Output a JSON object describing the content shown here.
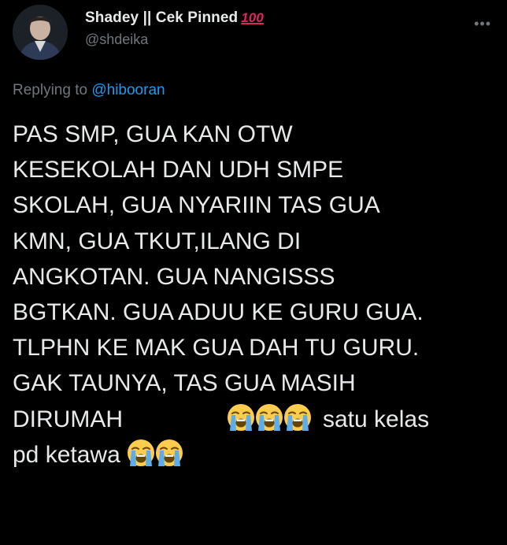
{
  "author": {
    "display_name": "Shadey || Cek Pinned",
    "name_emoji": "100",
    "handle": "@shdeika",
    "more_icon": "more-icon"
  },
  "reply": {
    "prefix": "Replying to",
    "handle": "@hibooran"
  },
  "tweet": {
    "lines": [
      "PAS SMP, GUA KAN OTW",
      "KESEKOLAH DAN UDH SMPE",
      "SKOLAH, GUA NYARIIN TAS GUA",
      "KMN, GUA TKUT,ILANG DI",
      "ANGKOTAN. GUA NANGISSS",
      "BGTKAN. GUA ADUU KE GURU GUA.",
      "TLPHN KE MAK GUA DAH TU GURU.",
      "GAK TAUNYA, TAS GUA MASIH"
    ],
    "line9_text": "DIRUMAH",
    "line9_tail": "satu kelas",
    "line10_text": "pd ketawa",
    "emoji": "loudly-crying-face",
    "colors": {
      "text": "#e7e9ea",
      "muted": "#71767b",
      "link": "#1d9bf0",
      "background": "#000000"
    }
  }
}
